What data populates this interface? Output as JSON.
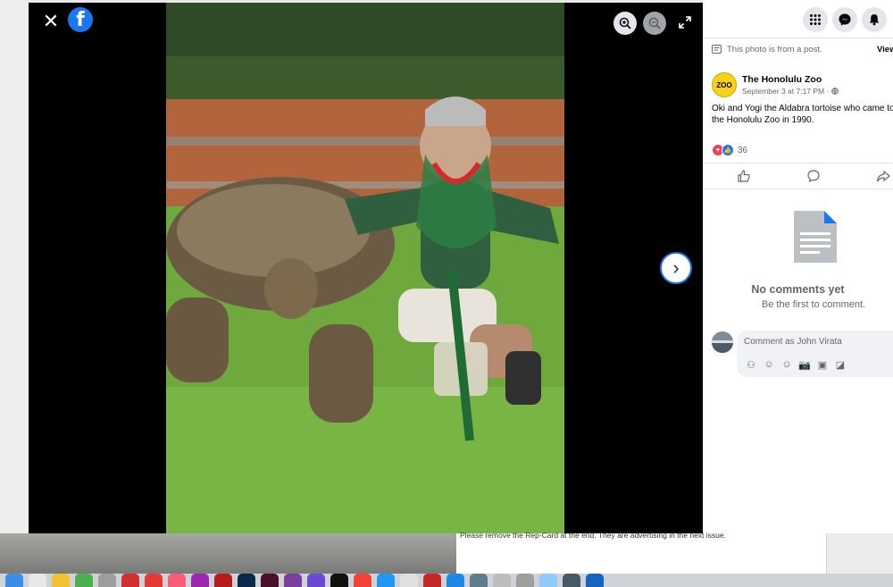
{
  "viewer": {
    "close_label": "✕",
    "logo_letter": "f",
    "next_label": "›"
  },
  "panel": {
    "post_note": "This photo is from a post.",
    "view_link": "View",
    "page_name": "The Honolulu Zoo",
    "avatar_text": "ZOO",
    "post_time": "September 3 at 7:17 PM · ",
    "caption": "Oki and Yogi the Aldabra tortoise who came to the Honolulu Zoo in 1990.",
    "reaction_count": "36",
    "no_comments": "No comments yet",
    "be_first": "Be the first to comment.",
    "comment_placeholder": "Comment as John Virata"
  },
  "background": {
    "doc_text": "Please remove the Rep-Card at the end. They are advertising in the next issue."
  },
  "colors": {
    "facebook_blue": "#1877f2",
    "like_blue": "#1877f2",
    "love_red": "#f33e58"
  }
}
